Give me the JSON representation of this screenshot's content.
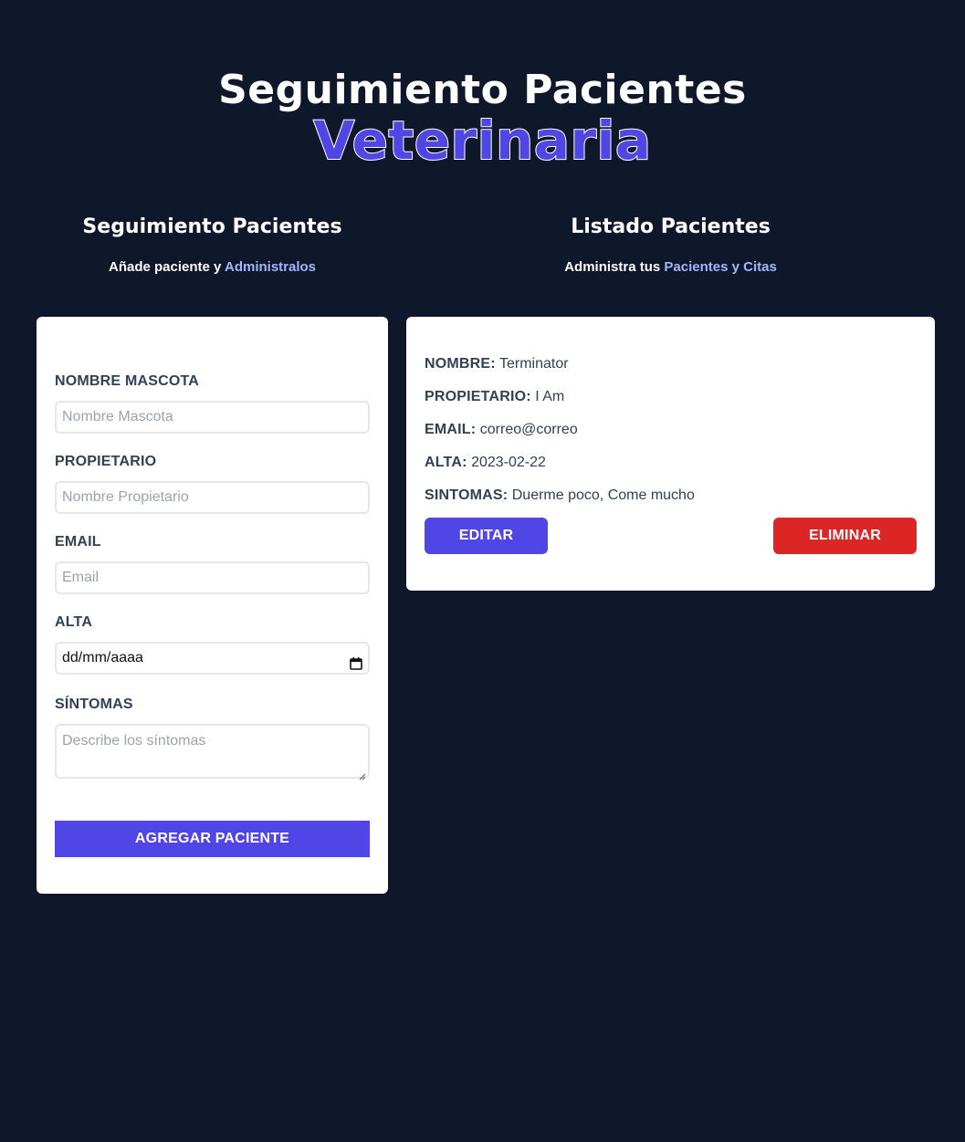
{
  "header": {
    "title_line1": "Seguimiento Pacientes",
    "title_line2": "Veterinaria"
  },
  "form_section": {
    "heading": "Seguimiento Pacientes",
    "subtitle_prefix": "Añade paciente y ",
    "subtitle_link": "Administralos"
  },
  "list_section": {
    "heading": "Listado Pacientes",
    "subtitle_prefix": "Administra tus ",
    "subtitle_link": "Pacientes y Citas"
  },
  "form": {
    "pet_name_label": "NOMBRE MASCOTA",
    "pet_name_placeholder": "Nombre Mascota",
    "owner_label": "PROPIETARIO",
    "owner_placeholder": "Nombre Propietario",
    "email_label": "EMAIL",
    "email_placeholder": "Email",
    "date_label": "ALTA",
    "date_placeholder": "dd/mm/aaaa",
    "symptoms_label": "SÍNTOMAS",
    "symptoms_placeholder": "Describe los síntomas",
    "submit_label": "AGREGAR PACIENTE"
  },
  "patient": {
    "name_label": "NOMBRE:",
    "name_value": "Terminator",
    "owner_label": "PROPIETARIO:",
    "owner_value": "I Am",
    "email_label": "EMAIL:",
    "email_value": "correo@correo",
    "date_label": "ALTA:",
    "date_value": "2023-02-22",
    "symptoms_label": "SINTOMAS:",
    "symptoms_value": "Duerme poco, Come mucho",
    "edit_label": "EDITAR",
    "delete_label": "ELIMINAR"
  },
  "colors": {
    "background": "#0f172a",
    "accent": "#4f46e5",
    "link": "#a5b4fc",
    "danger": "#dc2626"
  }
}
